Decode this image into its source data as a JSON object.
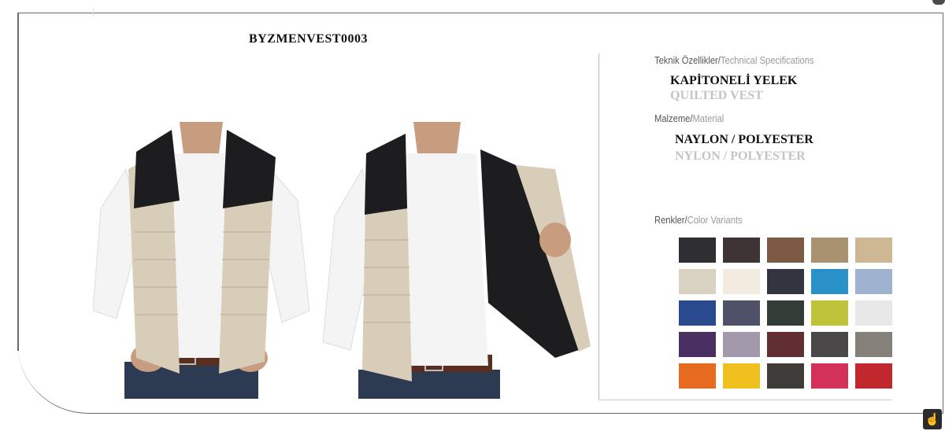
{
  "product_code": "BYZMENVEST0003",
  "specs": {
    "technical_tr": "Teknik Özellikler",
    "technical_en": "Technical Specifications",
    "name_tr": "KAPİTONELİ YELEK",
    "name_en": "QUILTED VEST",
    "material_label_tr": "Malzeme",
    "material_label_en": "Material",
    "material_tr": "NAYLON / POLYESTER",
    "material_en": "NYLON / POLYESTER",
    "colors_label_tr": "Renkler",
    "colors_label_en": "Color Variants"
  },
  "color_variants": [
    "#2f2f33",
    "#3f3434",
    "#7d5a44",
    "#a8926f",
    "#cdb893",
    "#d9d2c3",
    "#f2ece0",
    "#33343f",
    "#2a90c8",
    "#9fb2cf",
    "#2a4a8e",
    "#4e5168",
    "#323d38",
    "#bfc33a",
    "#e8e8e8",
    "#4a2f63",
    "#a399ad",
    "#612e33",
    "#4a4749",
    "#858079",
    "#e66a1f",
    "#f0c01e",
    "#3f3d3a",
    "#d4315a",
    "#c0282e"
  ],
  "icons": {
    "hand": "hand-pointer-icon"
  },
  "palette": {
    "vest_beige": "#d8cdb8",
    "vest_black": "#1d1d1f",
    "shirt": "#f4f4f4",
    "skin": "#c89c7e",
    "jeans": "#2c3a52",
    "belt": "#5a2e1e"
  }
}
